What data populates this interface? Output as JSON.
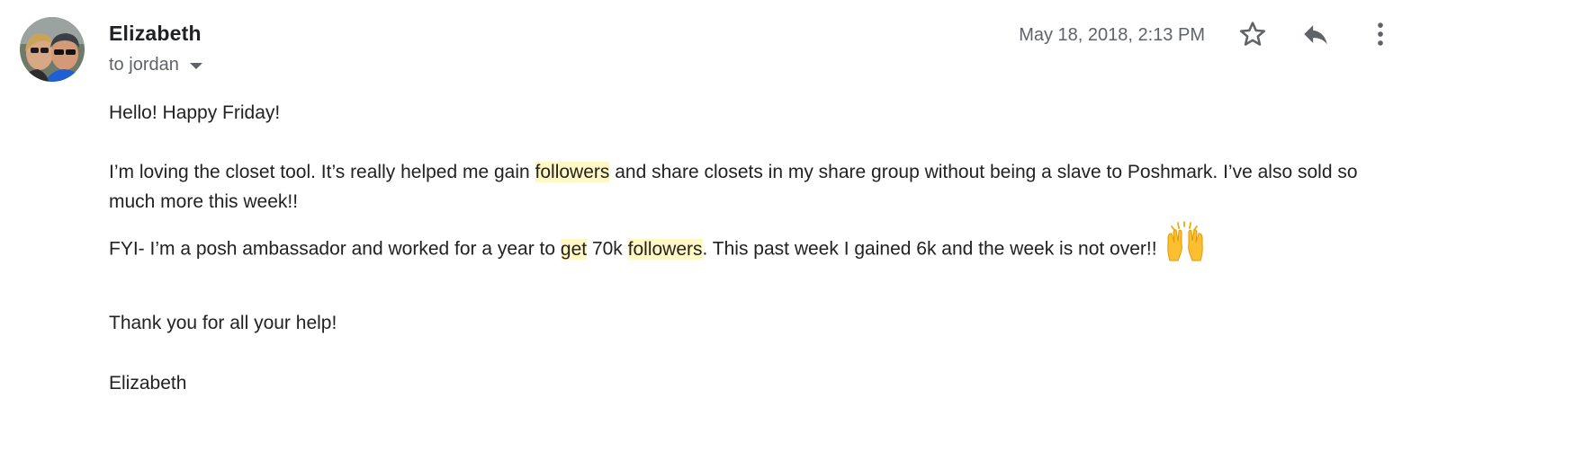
{
  "sender": {
    "name": "Elizabeth",
    "recipient_prefix": "to ",
    "recipient": "jordan"
  },
  "timestamp": "May 18, 2018, 2:13 PM",
  "icons": {
    "star": "star-icon",
    "reply": "reply-icon",
    "more": "more-vert-icon",
    "emoji": "raising-hands-emoji"
  },
  "colors": {
    "highlight": "#fff8c5",
    "secondary_text": "#5f6368",
    "body_text": "#222222"
  },
  "body": {
    "greeting": "Hello! Happy Friday!",
    "para1": {
      "a": "I’m loving the closet tool. It’s really helped me gain ",
      "hl1": "followers",
      "b": " and share closets in my share group without being a slave to Poshmark. I’ve also sold so much more this week!!"
    },
    "para2": {
      "a": "FYI- I’m a posh ambassador and worked for a year to ",
      "hl1": "get",
      "b": " 70k ",
      "hl2": "followers",
      "c": ". This past week I gained 6k and the week is not over!!"
    },
    "thanks": "Thank you for all your help!",
    "signature": "Elizabeth"
  }
}
